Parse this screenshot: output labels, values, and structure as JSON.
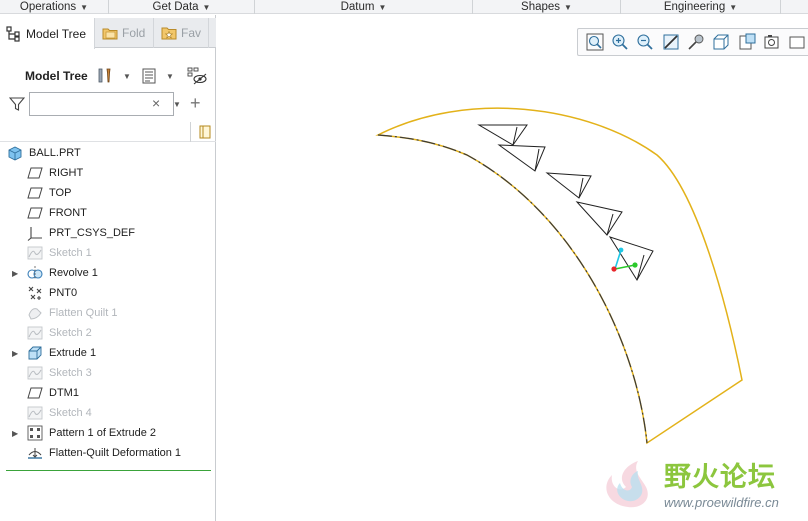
{
  "ribbon": {
    "groups": [
      {
        "label": "Operations"
      },
      {
        "label": "Get Data"
      },
      {
        "label": "Datum"
      },
      {
        "label": "Shapes"
      },
      {
        "label": "Engineering"
      }
    ]
  },
  "tabs": [
    {
      "label": "Model Tree",
      "icon": "model-tree-icon",
      "active": true
    },
    {
      "label": "Fold",
      "icon": "folder-icon",
      "active": false
    },
    {
      "label": "Fav",
      "icon": "favorites-icon",
      "active": false
    }
  ],
  "toolbar": {
    "title": "Model Tree",
    "settings_icon": "tools-icon",
    "show_icon": "show-columns-icon",
    "filter_icon": "visibility-filter-icon"
  },
  "search": {
    "value": "",
    "placeholder": "",
    "clear_glyph": "×"
  },
  "tree": {
    "root": {
      "label": "BALL.PRT",
      "icon": "part-icon"
    },
    "items": [
      {
        "label": "RIGHT",
        "icon": "datum-plane-icon",
        "dim": false,
        "expandable": false
      },
      {
        "label": "TOP",
        "icon": "datum-plane-icon",
        "dim": false,
        "expandable": false
      },
      {
        "label": "FRONT",
        "icon": "datum-plane-icon",
        "dim": false,
        "expandable": false
      },
      {
        "label": "PRT_CSYS_DEF",
        "icon": "csys-icon",
        "dim": false,
        "expandable": false
      },
      {
        "label": "Sketch 1",
        "icon": "sketch-icon",
        "dim": true,
        "expandable": false
      },
      {
        "label": "Revolve 1",
        "icon": "revolve-icon",
        "dim": false,
        "expandable": true
      },
      {
        "label": "PNT0",
        "icon": "datum-point-icon",
        "dim": false,
        "expandable": false
      },
      {
        "label": "Flatten Quilt 1",
        "icon": "flatten-quilt-icon",
        "dim": true,
        "expandable": false
      },
      {
        "label": "Sketch 2",
        "icon": "sketch-icon",
        "dim": true,
        "expandable": false
      },
      {
        "label": "Extrude 1",
        "icon": "extrude-icon",
        "dim": false,
        "expandable": true
      },
      {
        "label": "Sketch 3",
        "icon": "sketch-icon",
        "dim": true,
        "expandable": false
      },
      {
        "label": "DTM1",
        "icon": "datum-plane-icon",
        "dim": false,
        "expandable": false
      },
      {
        "label": "Sketch 4",
        "icon": "sketch-icon",
        "dim": true,
        "expandable": false
      },
      {
        "label": "Pattern 1 of Extrude 2",
        "icon": "pattern-icon",
        "dim": false,
        "expandable": true
      },
      {
        "label": "Flatten-Quilt Deformation 1",
        "icon": "deformation-icon",
        "dim": false,
        "expandable": false
      }
    ]
  },
  "view_toolbar": [
    "refit-icon",
    "zoom-in-icon",
    "zoom-out-icon",
    "repaint-icon",
    "display-style-icon",
    "saved-views-icon",
    "view-manager-icon",
    "perspective-icon",
    "named-views-icon"
  ],
  "watermark": {
    "text_cn": "野火论坛",
    "url": "www.proewildfire.cn"
  },
  "colors": {
    "edge": "#e3b21a",
    "selection": "#3aa33a",
    "csys_x": "#e8262b",
    "csys_y": "#2ac92a",
    "csys_z": "#1fc8e6"
  }
}
